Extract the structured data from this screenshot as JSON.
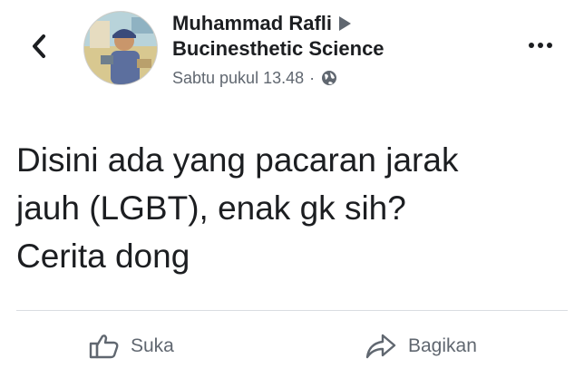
{
  "post": {
    "author_name": "Muhammad Rafli",
    "group_name": "Bucinesthetic Science",
    "timestamp": "Sabtu pukul 13.48",
    "separator": "·",
    "privacy_icon": "globe-icon",
    "body_lines": [
      "Disini ada yang pacaran jarak",
      "jauh (LGBT), enak gk sih?",
      "Cerita dong"
    ]
  },
  "actions": {
    "like_label": "Suka",
    "like_icon": "thumbs-up-icon",
    "share_label": "Bagikan",
    "share_icon": "share-arrow-icon"
  },
  "icons": {
    "back": "chevron-left-icon",
    "more": "more-options-icon",
    "post_to": "triangle-right-icon"
  }
}
